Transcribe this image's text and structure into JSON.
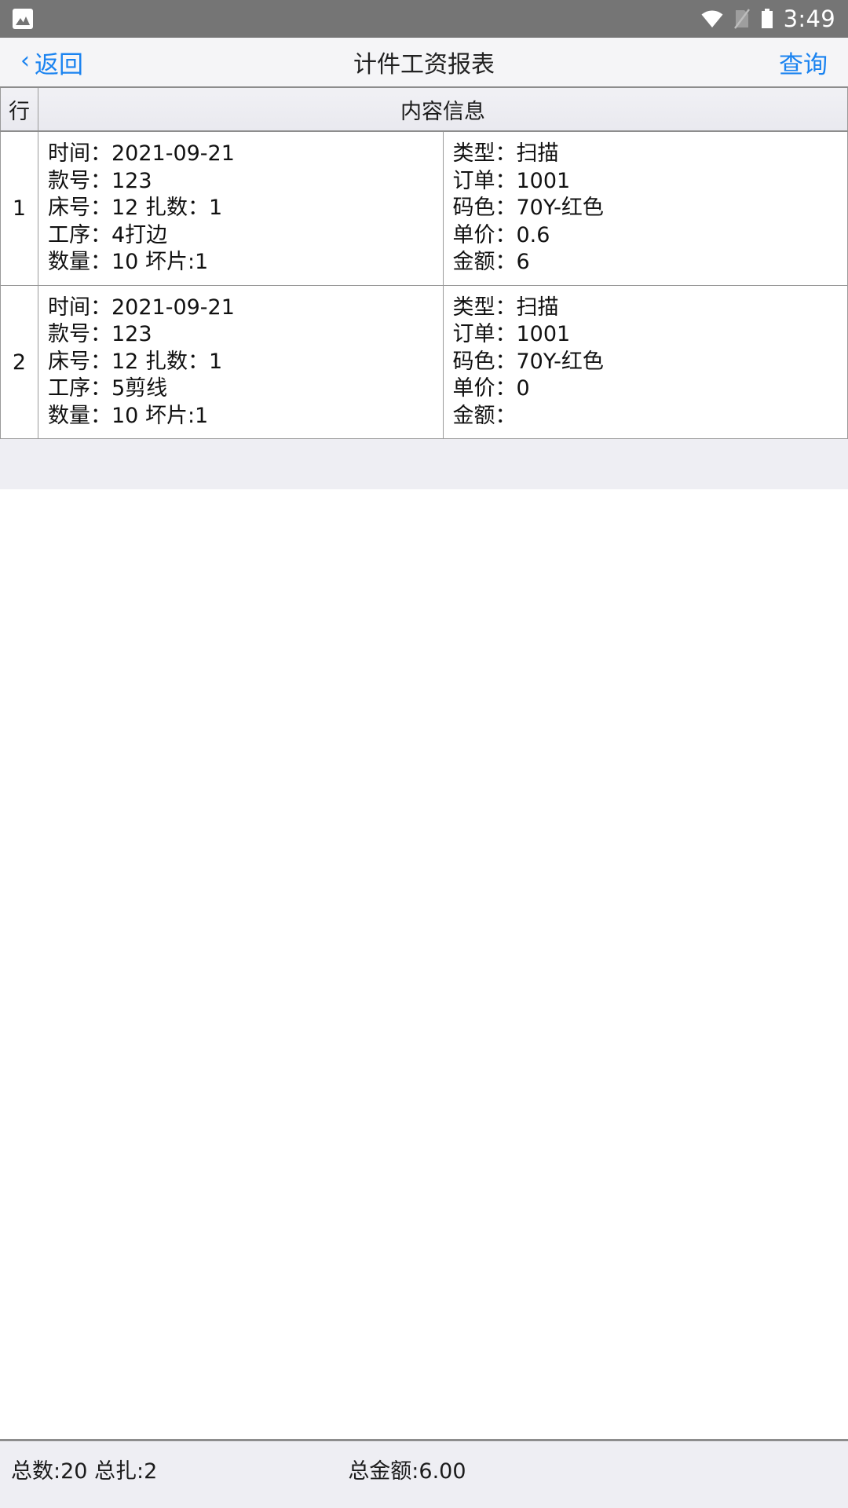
{
  "status_bar": {
    "notification_icon": "photo-icon",
    "wifi_icon": "wifi-icon",
    "sim_icon": "no-sim-icon",
    "battery_icon": "battery-icon",
    "time": "3:49",
    "background_color": "#757575"
  },
  "nav_bar": {
    "back_chevron": "‹",
    "back_label": "返回",
    "title": "计件工资报表",
    "action_label": "查询",
    "accent_color": "#1a83f0",
    "background_color": "#f5f5f7"
  },
  "table": {
    "headers": {
      "index": "行",
      "content": "内容信息"
    },
    "rows": [
      {
        "index": "1",
        "left": [
          "时间：2021-09-21",
          "款号：123",
          "床号：12 扎数：1",
          "工序：4打边",
          "数量：10 坏片:1"
        ],
        "right": [
          "类型：扫描",
          "订单：1001",
          "码色：70Y-红色",
          "单价：0.6",
          "金额：6"
        ]
      },
      {
        "index": "2",
        "left": [
          "时间：2021-09-21",
          "款号：123",
          "床号：12 扎数：1",
          "工序：5剪线",
          "数量：10 坏片:1"
        ],
        "right": [
          "类型：扫描",
          "订单：1001",
          "码色：70Y-红色",
          "单价：0",
          "金额："
        ]
      }
    ]
  },
  "footer": {
    "totals_count": "总数:20 总扎:2",
    "totals_amount": "总金额:6.00",
    "background_color": "#eeeef3"
  }
}
